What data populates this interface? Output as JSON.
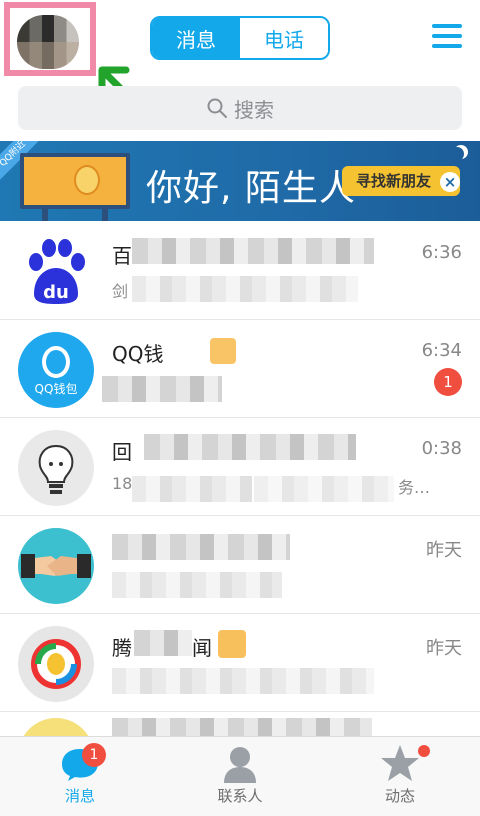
{
  "header": {
    "tabs": [
      {
        "label": "消息",
        "active": true
      },
      {
        "label": "电话",
        "active": false
      }
    ],
    "search_placeholder": "搜索"
  },
  "banner": {
    "corner_label": "QQ附近",
    "title": "你好, 陌生人",
    "button_label": "寻找新朋友",
    "close_symbol": "×"
  },
  "conversations": [
    {
      "name": "百",
      "preview": "剑",
      "time": "6:36",
      "icon": "baidu-paw-icon"
    },
    {
      "name": "QQ钱",
      "preview": "",
      "time": "6:34",
      "unread": "1",
      "icon": "qq-wallet-icon",
      "icon_label": "QQ钱包"
    },
    {
      "name": "回",
      "preview": "18",
      "preview_tail": "务…",
      "time": "0:38",
      "icon": "lightbulb-face-icon"
    },
    {
      "name": "",
      "preview": "",
      "time": "昨天",
      "icon": "handshake-icon"
    },
    {
      "name": "腾",
      "name_tail": "闻",
      "preview": "",
      "time": "昨天",
      "icon": "tencent-news-icon"
    }
  ],
  "bottom_nav": [
    {
      "label": "消息",
      "badge": "1",
      "icon": "message-bubble-icon"
    },
    {
      "label": "联系人",
      "icon": "contact-person-icon"
    },
    {
      "label": "动态",
      "icon": "star-icon"
    }
  ],
  "colors": {
    "accent": "#12a8ea",
    "badge": "#f04e3e",
    "banner": "#1f6aa7",
    "highlight_box": "#f08aa8",
    "arrow": "#22a32c"
  }
}
